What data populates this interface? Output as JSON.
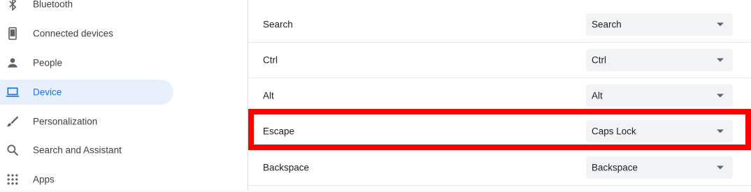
{
  "sidebar": {
    "items": [
      {
        "label": "Bluetooth",
        "icon": "bluetooth-icon"
      },
      {
        "label": "Connected devices",
        "icon": "phone-icon"
      },
      {
        "label": "People",
        "icon": "person-icon"
      },
      {
        "label": "Device",
        "icon": "laptop-icon",
        "active": true
      },
      {
        "label": "Personalization",
        "icon": "brush-icon"
      },
      {
        "label": "Search and Assistant",
        "icon": "search-icon"
      },
      {
        "label": "Apps",
        "icon": "apps-grid-icon"
      }
    ]
  },
  "keyboard": {
    "rows": [
      {
        "label": "Search",
        "value": "Search"
      },
      {
        "label": "Ctrl",
        "value": "Ctrl"
      },
      {
        "label": "Alt",
        "value": "Alt"
      },
      {
        "label": "Escape",
        "value": "Caps Lock"
      },
      {
        "label": "Backspace",
        "value": "Backspace"
      }
    ]
  },
  "colors": {
    "accent": "#1a73e8",
    "active_bg": "#e8f0fe",
    "highlight": "#ff0000",
    "icon_gray": "#5f6368"
  }
}
